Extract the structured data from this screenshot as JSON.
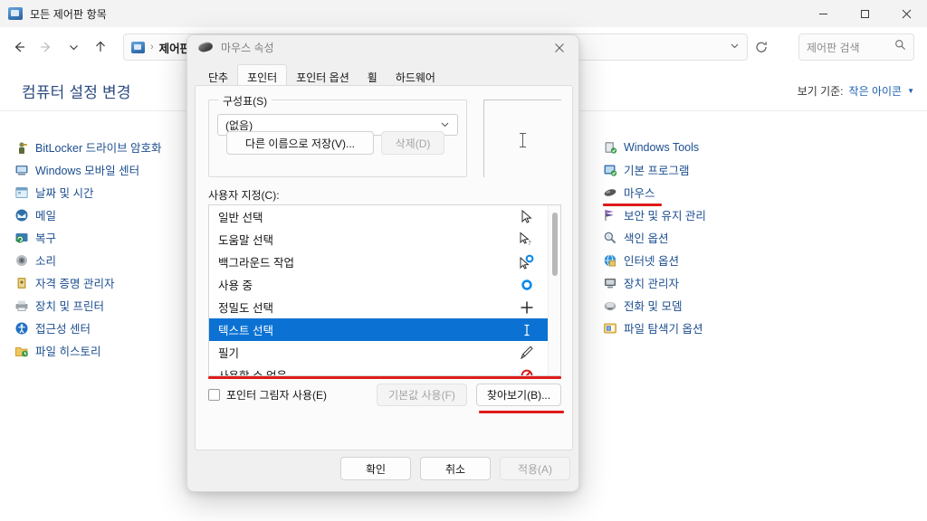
{
  "window": {
    "title": "모든 제어판 항목",
    "title_icon": "control-panel-icon",
    "controls": {
      "minimize": "최소화",
      "maximize": "최대화",
      "close": "닫기"
    }
  },
  "addressbar": {
    "back": "뒤로",
    "forward": "앞으로",
    "recent": "최근 위치",
    "up": "위로",
    "crumb_icon": "control-panel-icon",
    "separator": "›",
    "crumb": "제어판",
    "dropdown": "이전 위치",
    "refresh": "새로 고침"
  },
  "search": {
    "placeholder": "제어판 검색",
    "icon": "search-icon"
  },
  "content": {
    "heading": "컴퓨터 설정 변경",
    "view_by_label": "보기 기준:",
    "view_by_value": "작은 아이콘",
    "left_items": [
      {
        "label": "BitLocker 드라이브 암호화",
        "icon": "bitlocker-icon"
      },
      {
        "label": "Windows 모바일 센터",
        "icon": "mobility-center-icon"
      },
      {
        "label": "날짜 및 시간",
        "icon": "date-time-icon"
      },
      {
        "label": "메일",
        "icon": "mail-icon"
      },
      {
        "label": "복구",
        "icon": "recovery-icon"
      },
      {
        "label": "소리",
        "icon": "sound-icon"
      },
      {
        "label": "자격 증명 관리자",
        "icon": "credential-manager-icon"
      },
      {
        "label": "장치 및 프린터",
        "icon": "devices-printers-icon"
      },
      {
        "label": "접근성 센터",
        "icon": "ease-of-access-icon"
      },
      {
        "label": "파일 히스토리",
        "icon": "file-history-icon"
      }
    ],
    "right_items": [
      {
        "label": "Windows Tools",
        "icon": "windows-tools-icon",
        "underlined": false
      },
      {
        "label": "기본 프로그램",
        "icon": "default-programs-icon",
        "underlined": false
      },
      {
        "label": "마우스",
        "icon": "mouse-icon",
        "underlined": true
      },
      {
        "label": "보안 및 유지 관리",
        "icon": "security-maintenance-icon",
        "underlined": false
      },
      {
        "label": "색인 옵션",
        "icon": "indexing-options-icon",
        "underlined": false
      },
      {
        "label": "인터넷 옵션",
        "icon": "internet-options-icon",
        "underlined": false
      },
      {
        "label": "장치 관리자",
        "icon": "device-manager-icon",
        "underlined": false
      },
      {
        "label": "전화 및 모뎀",
        "icon": "phone-modem-icon",
        "underlined": false
      },
      {
        "label": "파일 탐색기 옵션",
        "icon": "file-explorer-options-icon",
        "underlined": false
      }
    ]
  },
  "dialog": {
    "title": "마우스 속성",
    "title_icon": "mouse-icon",
    "close": "닫기",
    "tabs": [
      {
        "label": "단추",
        "selected": false
      },
      {
        "label": "포인터",
        "selected": true
      },
      {
        "label": "포인터 옵션",
        "selected": false
      },
      {
        "label": "휠",
        "selected": false
      },
      {
        "label": "하드웨어",
        "selected": false
      }
    ],
    "scheme_group_label": "구성표(S)",
    "scheme_value": "(없음)",
    "save_as_label": "다른 이름으로 저장(V)...",
    "delete_label": "삭제(D)",
    "preview_cursor": "ibeam-cursor",
    "customize_label": "사용자 지정(C):",
    "cursor_list": [
      {
        "label": "일반 선택",
        "cursor": "arrow-cursor",
        "selected": false
      },
      {
        "label": "도움말 선택",
        "cursor": "arrow-help-cursor",
        "selected": false
      },
      {
        "label": "백그라운드 작업",
        "cursor": "arrow-busy-cursor",
        "selected": false
      },
      {
        "label": "사용 중",
        "cursor": "busy-ring-cursor",
        "selected": false
      },
      {
        "label": "정밀도 선택",
        "cursor": "crosshair-cursor",
        "selected": false
      },
      {
        "label": "텍스트 선택",
        "cursor": "ibeam-cursor",
        "selected": true
      },
      {
        "label": "필기",
        "cursor": "pen-cursor",
        "selected": false
      },
      {
        "label": "사용할 수 없음",
        "cursor": "unavailable-cursor",
        "selected": false
      }
    ],
    "shadow_checkbox_label": "포인터 그림자 사용(E)",
    "shadow_checked": false,
    "use_default_label": "기본값 사용(F)",
    "browse_label": "찾아보기(B)...",
    "ok_label": "확인",
    "cancel_label": "취소",
    "apply_label": "적용(A)"
  },
  "annotations": {
    "highlight_color": "#e01b1b",
    "selection_color": "#0b72d4",
    "accent_link_color": "#1c4e8f"
  }
}
